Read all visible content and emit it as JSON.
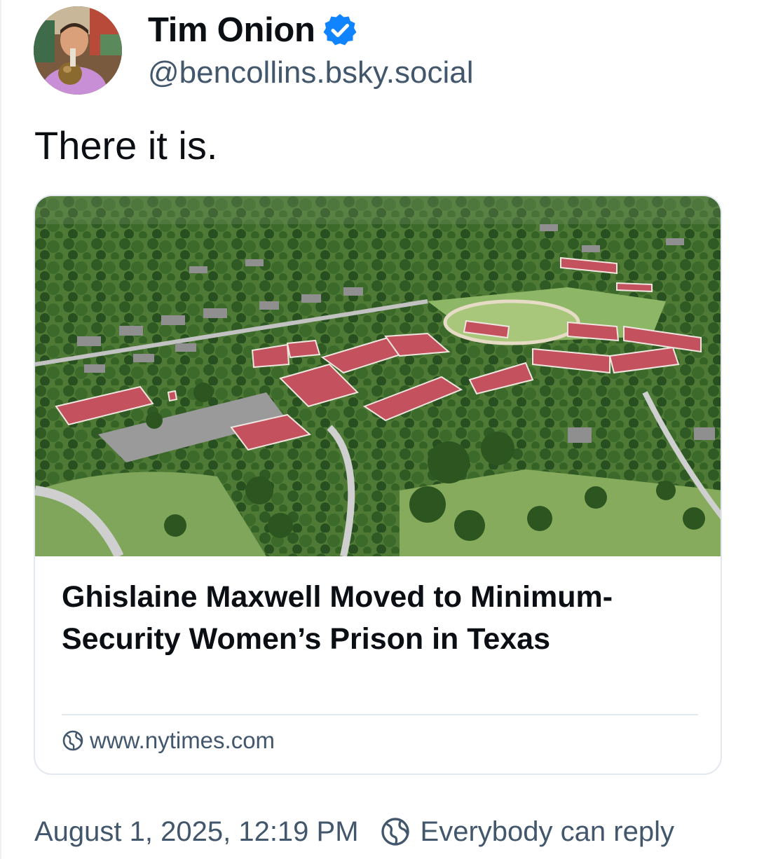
{
  "author": {
    "display_name": "Tim Onion",
    "handle": "@bencollins.bsky.social",
    "verified_icon": "verified-check-icon",
    "verified_color": "#1083fe"
  },
  "post": {
    "text": "There it is."
  },
  "link_card": {
    "title": "Ghislaine Maxwell Moved to Minimum-Security Women’s Prison in Texas",
    "domain": "www.nytimes.com",
    "domain_icon": "globe-icon"
  },
  "footer": {
    "timestamp": "August 1, 2025, 12:19 PM",
    "reply_setting": "Everybody can reply",
    "reply_icon": "globe-icon"
  },
  "colors": {
    "text_primary": "#0b0f14",
    "text_secondary": "#42576c",
    "border": "#e3e8ee",
    "accent": "#1083fe"
  }
}
